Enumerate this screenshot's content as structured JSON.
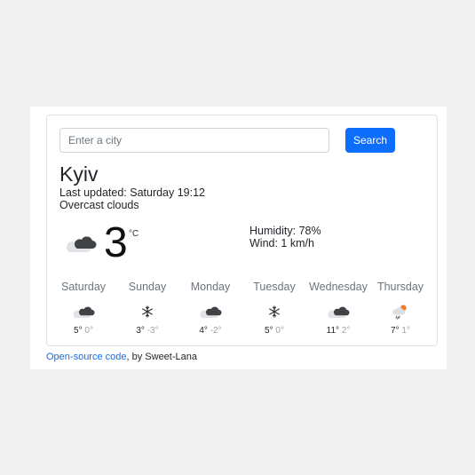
{
  "search": {
    "placeholder": "Enter a city",
    "value": "",
    "button_label": "Search"
  },
  "current": {
    "city": "Kyiv",
    "last_updated": "Last updated: Saturday 19:12",
    "description": "Overcast clouds",
    "temperature": "3",
    "unit": "°C",
    "icon": "overcast-clouds-icon",
    "humidity": "Humidity: 78%",
    "wind": "Wind: 1 km/h"
  },
  "forecast": [
    {
      "day": "Saturday",
      "icon": "overcast-clouds-icon",
      "max": "5°",
      "min": "0°"
    },
    {
      "day": "Sunday",
      "icon": "snow-icon",
      "max": "3°",
      "min": "-3°"
    },
    {
      "day": "Monday",
      "icon": "overcast-clouds-icon",
      "max": "4°",
      "min": "-2°"
    },
    {
      "day": "Tuesday",
      "icon": "snow-icon",
      "max": "5°",
      "min": "0°"
    },
    {
      "day": "Wednesday",
      "icon": "overcast-clouds-icon",
      "max": "11°",
      "min": "2°"
    },
    {
      "day": "Thursday",
      "icon": "sun-rain-icon",
      "max": "7°",
      "min": "1°"
    }
  ],
  "footer": {
    "link_text": "Open-source code",
    "suffix": ", by Sweet-Lana"
  },
  "colors": {
    "accent": "#0d6efd",
    "background": "#f1f1f2",
    "muted": "#6c757d"
  }
}
